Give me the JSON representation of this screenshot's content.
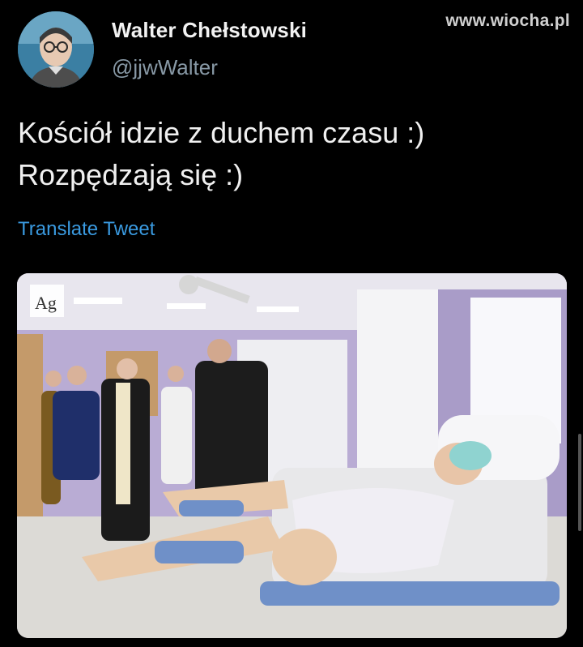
{
  "tweet": {
    "display_name": "Walter Chełstowski",
    "handle": "@jjwWalter",
    "text_lines": [
      "Kościół idzie z duchem czasu :)",
      "Rozpędzają się :)"
    ],
    "translate_label": "Translate Tweet",
    "avatar_icon": "user-avatar-photo",
    "media": {
      "description_icon": "hospital-room-photo",
      "badge_text": "Ag"
    }
  },
  "watermark": "www.wiocha.pl",
  "colors": {
    "background": "#000000",
    "link": "#3a9ae0",
    "handle": "#8899a6",
    "text": "#f0f0f0"
  }
}
